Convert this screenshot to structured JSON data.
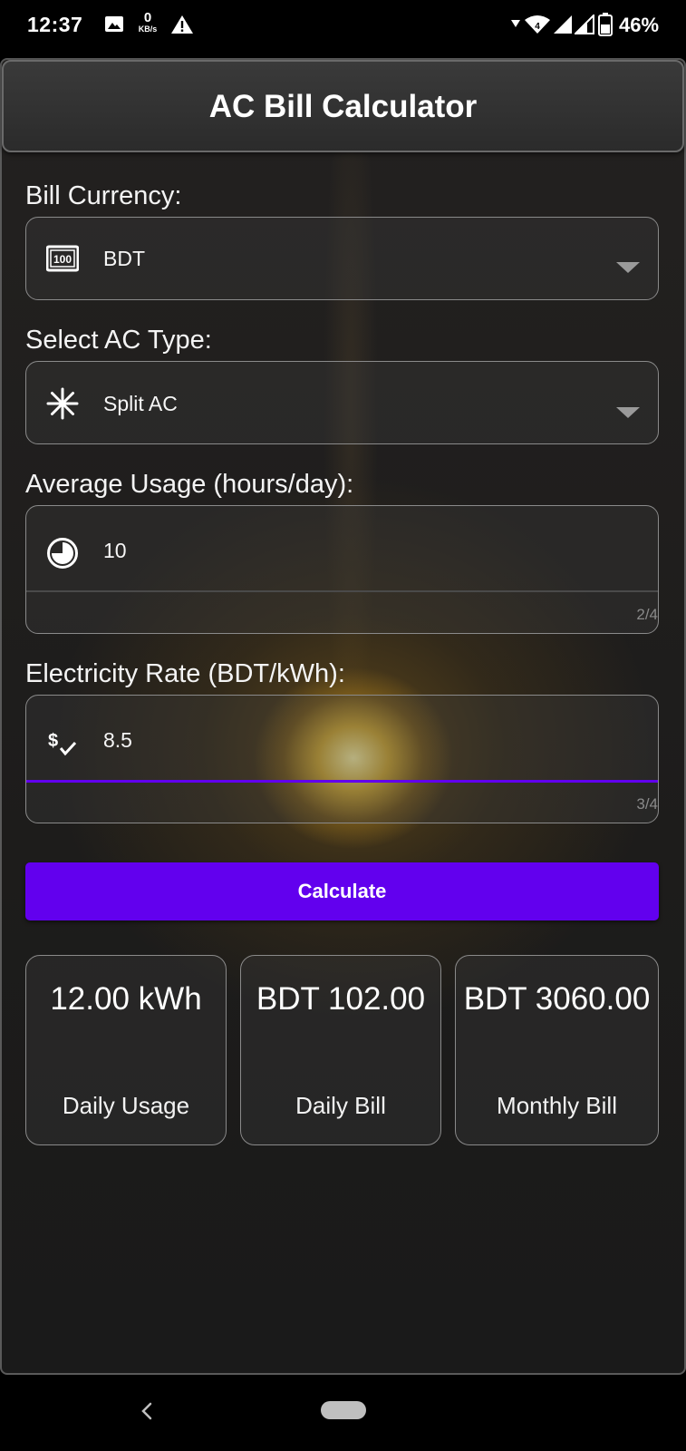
{
  "status_bar": {
    "time": "12:37",
    "speed_value": "0",
    "speed_unit": "KB/s",
    "network_badge": "4",
    "battery": "46%"
  },
  "app": {
    "title": "AC Bill Calculator"
  },
  "form": {
    "currency": {
      "label": "Bill Currency:",
      "value": "BDT",
      "icon": "money-icon"
    },
    "ac_type": {
      "label": "Select AC Type:",
      "value": "Split AC",
      "icon": "snowflake-icon"
    },
    "usage": {
      "label": "Average Usage (hours/day):",
      "value": "10",
      "counter": "2/4",
      "icon": "clock-icon"
    },
    "rate": {
      "label": "Electricity Rate (BDT/kWh):",
      "value": "8.5",
      "counter": "3/4",
      "icon": "price-check-icon"
    }
  },
  "calculate_label": "Calculate",
  "results": [
    {
      "value": "12.00 kWh",
      "label": "Daily Usage"
    },
    {
      "value": "BDT 102.00",
      "label": "Daily Bill"
    },
    {
      "value": "BDT 3060.00",
      "label": "Monthly Bill"
    }
  ],
  "colors": {
    "accent": "#6200ee",
    "background": "#1d1c1b",
    "field_border": "#8a8a8a"
  }
}
